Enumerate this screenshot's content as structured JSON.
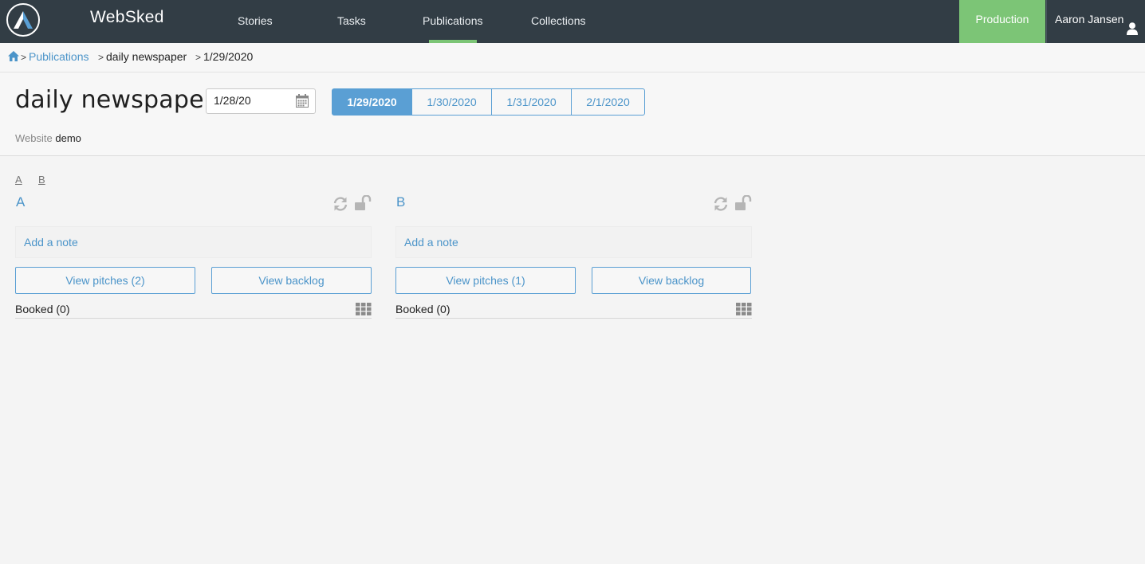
{
  "navbar": {
    "brand": "WebSked",
    "items": [
      {
        "label": "Stories"
      },
      {
        "label": "Tasks"
      },
      {
        "label": "Publications"
      },
      {
        "label": "Collections"
      }
    ],
    "production_label": "Production",
    "user_name": "Aaron Jansen"
  },
  "breadcrumb": {
    "publications": "Publications",
    "publication": "daily newspaper",
    "date": "1/29/2020",
    "separator": ">"
  },
  "header": {
    "title": "daily newspaper",
    "date_input_value": "1/28/20",
    "date_tabs": [
      {
        "label": "1/29/2020",
        "active": true
      },
      {
        "label": "1/30/2020",
        "active": false
      },
      {
        "label": "1/31/2020",
        "active": false
      },
      {
        "label": "2/1/2020",
        "active": false
      }
    ],
    "website_label": "Website",
    "website_value": "demo"
  },
  "anchors": [
    "A",
    "B"
  ],
  "sections": [
    {
      "title": "A",
      "note_placeholder": "Add a note",
      "pitches_label": "View pitches  (2)",
      "backlog_label": "View backlog",
      "booked_label": "Booked (0)"
    },
    {
      "title": "B",
      "note_placeholder": "Add a note",
      "pitches_label": "View pitches  (1)",
      "backlog_label": "View backlog",
      "booked_label": "Booked (0)"
    }
  ],
  "colors": {
    "navbar_bg": "#323d45",
    "accent_green": "#7cc576",
    "link_blue": "#4b94c9",
    "tab_active_blue": "#5a9fd4"
  },
  "icons": [
    "app-logo-icon",
    "user-icon",
    "home-icon",
    "calendar-icon",
    "refresh-icon",
    "lock-open-icon",
    "grid-icon"
  ]
}
